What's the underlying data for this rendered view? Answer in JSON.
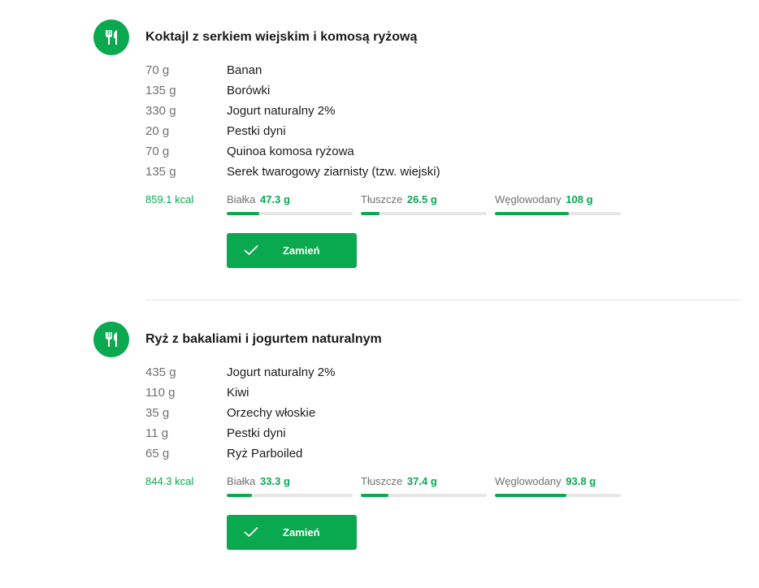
{
  "meals": [
    {
      "title": "Koktajl z serkiem wiejskim i komosą ryżową",
      "icon": "fork-knife-icon",
      "ingredients": [
        {
          "qty": "70 g",
          "name": "Banan"
        },
        {
          "qty": "135 g",
          "name": "Borówki"
        },
        {
          "qty": "330 g",
          "name": "Jogurt naturalny 2%"
        },
        {
          "qty": "20 g",
          "name": "Pestki dyni"
        },
        {
          "qty": "70 g",
          "name": "Quinoa komosa ryżowa"
        },
        {
          "qty": "135 g",
          "name": "Serek twarogowy ziarnisty (tzw. wiejski)"
        }
      ],
      "kcal": "859.1 kcal",
      "macros": [
        {
          "label": "Białka",
          "value": "47.3 g",
          "fill": 0.26
        },
        {
          "label": "Tłuszcze",
          "value": "26.5 g",
          "fill": 0.15
        },
        {
          "label": "Węglowodany",
          "value": "108 g",
          "fill": 0.59
        }
      ],
      "button_label": "Zamień"
    },
    {
      "title": "Ryż z bakaliami i jogurtem naturalnym",
      "icon": "fork-knife-icon",
      "ingredients": [
        {
          "qty": "435 g",
          "name": "Jogurt naturalny 2%"
        },
        {
          "qty": "110 g",
          "name": "Kiwi"
        },
        {
          "qty": "35 g",
          "name": "Orzechy włoskie"
        },
        {
          "qty": "11 g",
          "name": "Pestki dyni"
        },
        {
          "qty": "65 g",
          "name": "Ryż Parboiled"
        }
      ],
      "kcal": "844.3 kcal",
      "macros": [
        {
          "label": "Białka",
          "value": "33.3 g",
          "fill": 0.2
        },
        {
          "label": "Tłuszcze",
          "value": "37.4 g",
          "fill": 0.22
        },
        {
          "label": "Węglowodany",
          "value": "93.8 g",
          "fill": 0.57
        }
      ],
      "button_label": "Zamień"
    }
  ],
  "colors": {
    "accent": "#0aa84f",
    "muted_text": "#707070",
    "track": "#e6e6e6"
  }
}
